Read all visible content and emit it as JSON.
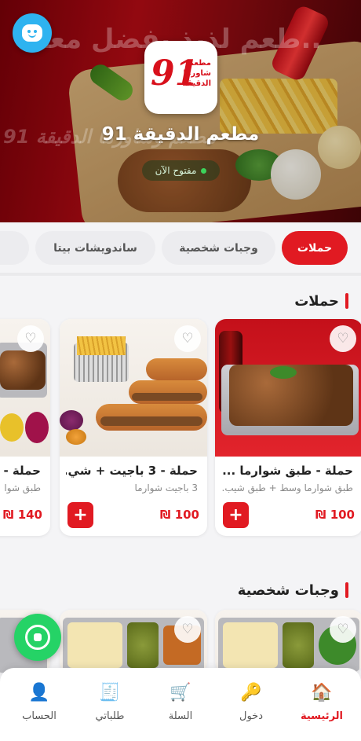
{
  "hero": {
    "bg_slogan": "طعم لذيذ يفضل معاك..",
    "bg_logo_text": "91 مطعم وشاورما الدقيقة",
    "logo": {
      "number": "91",
      "text_lines": [
        "مطعم",
        "شاورما",
        "الدقيقة"
      ]
    },
    "restaurant_name": "مطعم الدقيقة 91",
    "status": "مفتوح الآن",
    "status_color": "#3cd35b"
  },
  "tabs": [
    {
      "label": "حملات",
      "active": true
    },
    {
      "label": "وجبات شخصية",
      "active": false
    },
    {
      "label": "ساندويشات بيتا",
      "active": false
    },
    {
      "label": "سن",
      "active": false
    }
  ],
  "sections": [
    {
      "title": "حملات",
      "cards": [
        {
          "name": "حملة - طبق شوارما ...",
          "desc": "طبق شوارما وسط + طبق شيب...",
          "price": "100 ₪"
        },
        {
          "name": "حملة - 3 باجيت + شي...",
          "desc": "3 باجيت شوارما",
          "price": "100 ₪"
        },
        {
          "name": "حملة -",
          "desc": "طبق شوا",
          "price": "140 ₪"
        }
      ]
    },
    {
      "title": "وجبات شخصية"
    }
  ],
  "add_symbol": "+",
  "heart_symbol": "♡",
  "nav": [
    {
      "label": "الرئيسية",
      "icon": "home-icon",
      "glyph": "🏠",
      "active": true
    },
    {
      "label": "دخول",
      "icon": "key-icon",
      "glyph": "🔑",
      "active": false
    },
    {
      "label": "السلة",
      "icon": "cart-icon",
      "glyph": "🛒",
      "active": false
    },
    {
      "label": "طلباتي",
      "icon": "receipt-icon",
      "glyph": "🧾",
      "active": false
    },
    {
      "label": "الحساب",
      "icon": "user-icon",
      "glyph": "👤",
      "active": false
    }
  ],
  "colors": {
    "brand_red": "#e11a22",
    "chat_blue": "#2eb3f0",
    "whatsapp_green": "#25d366"
  }
}
